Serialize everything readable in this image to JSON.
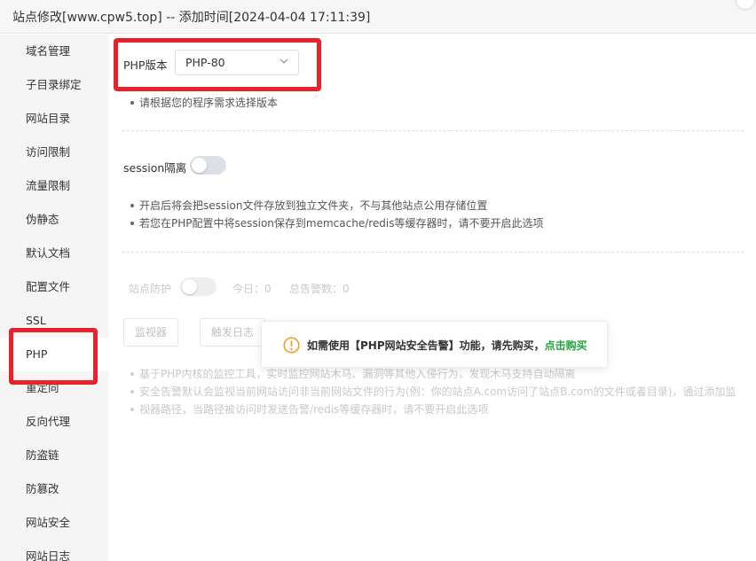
{
  "window": {
    "title": "站点修改[www.cpw5.top] -- 添加时间[2024-04-04 17:11:39]"
  },
  "sidebar": {
    "items": [
      {
        "label": "域名管理"
      },
      {
        "label": "子目录绑定"
      },
      {
        "label": "网站目录"
      },
      {
        "label": "访问限制"
      },
      {
        "label": "流量限制"
      },
      {
        "label": "伪静态"
      },
      {
        "label": "默认文档"
      },
      {
        "label": "配置文件"
      },
      {
        "label": "SSL"
      },
      {
        "label": "PHP",
        "active": true
      },
      {
        "label": "重定向"
      },
      {
        "label": "反向代理"
      },
      {
        "label": "防盗链"
      },
      {
        "label": "防篡改"
      },
      {
        "label": "网站安全"
      },
      {
        "label": "网站日志"
      }
    ]
  },
  "php": {
    "version_label": "PHP版本",
    "version_value": "PHP-80",
    "hint": "请根据您的程序需求选择版本"
  },
  "session": {
    "label": "session隔离",
    "enabled": false,
    "notes": [
      "开启后将会把session文件存放到独立文件夹，不与其他站点公用存储位置",
      "若您在PHP配置中将session保存到memcache/redis等缓存器时，请不要开启此选项"
    ]
  },
  "protect": {
    "label": "站点防护",
    "enabled": false,
    "today": "今日：0",
    "total_alerts": "总告警数：0",
    "monitor_button": "监视器",
    "trigger_log_button": "触发日志",
    "notes": [
      "基于PHP内核的监控工具，实时监控网站木马、漏洞等其他入侵行为，发现木马支持自动隔离",
      "安全告警默认会监视当前网站访问非当前网站文件的行为(例：你的站点A.com访问了站点B.com的文件或者目录)，通过添加监",
      "视器路径，当路径被访问时发送告警/redis等缓存器时，请不要开启此选项"
    ]
  },
  "toast": {
    "message": "如需使用【PHP网站安全告警】功能，请先购买，",
    "link": "点击购买"
  },
  "colors": {
    "accent_green": "#20a53a",
    "highlight_red": "#e8222b",
    "warn_orange": "#f0a020"
  }
}
